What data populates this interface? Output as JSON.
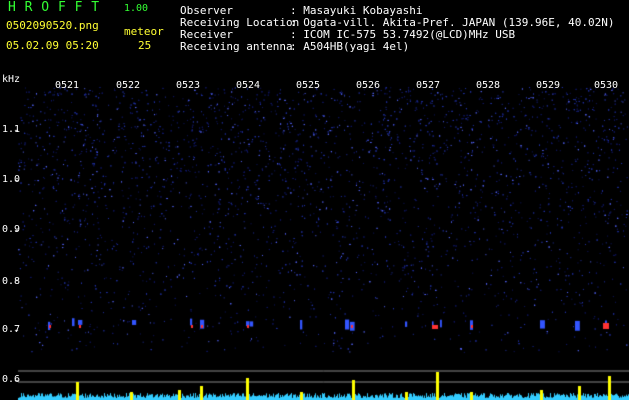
{
  "header": {
    "app_title": "H R O F F T",
    "version": "1.00",
    "filename": "0502090520.png",
    "datetime": "05.02.09 05:20",
    "meteor_label": "meteor",
    "meteor_count": "25"
  },
  "info": [
    {
      "label": "Observer",
      "value": ": Masayuki Kobayashi"
    },
    {
      "label": "Receiving Location",
      "value": ": Ogata-vill. Akita-Pref. JAPAN (139.96E, 40.02N)"
    },
    {
      "label": "Receiver",
      "value": ": ICOM IC-575 53.7492(@LCD)MHz USB"
    },
    {
      "label": "Receiving antenna",
      "value": ": A504HB(yagi 4el)"
    }
  ],
  "axis": {
    "unit": "kHz",
    "y_ticks": [
      "1.1",
      "1.0",
      "0.9",
      "0.8",
      "0.7",
      "0.6"
    ],
    "time_ticks": [
      "0521",
      "0522",
      "0523",
      "0524",
      "0525",
      "0526",
      "0527",
      "0528",
      "0529",
      "0530"
    ]
  },
  "colors": {
    "background": "#000000",
    "noise": "#2233aa",
    "header_green": "#33ff33",
    "text": "#ffffff",
    "meteor_echo": "#ff3333",
    "histogram_yellow": "#ffff00",
    "histogram_cyan": "#33ccff"
  }
}
